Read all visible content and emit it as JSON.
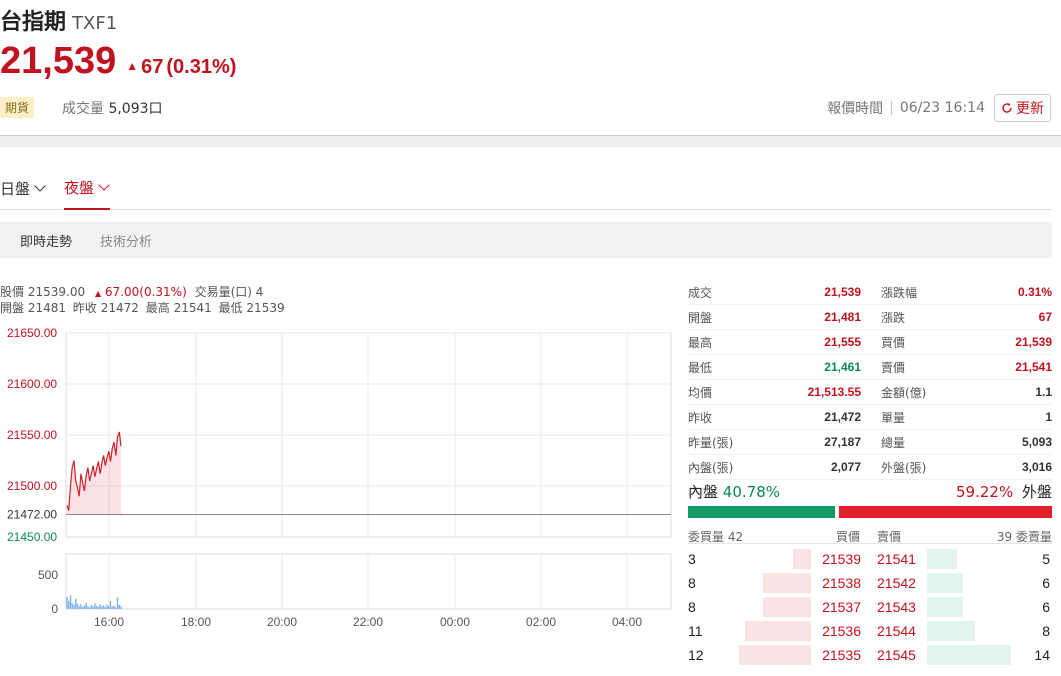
{
  "header": {
    "name": "台指期",
    "code": "TXF1",
    "price": "21,539",
    "change": "67",
    "change_pct": "(0.31%)",
    "badge": "期貨",
    "volume_label": "成交量",
    "volume_value": "5,093口",
    "quote_time_label": "報價時間",
    "quote_time": "06/23 16:14",
    "refresh_label": "更新"
  },
  "session_tabs": [
    {
      "label": "日盤",
      "active": false
    },
    {
      "label": "夜盤",
      "active": true
    }
  ],
  "sub_tabs": [
    {
      "label": "即時走勢",
      "active": true
    },
    {
      "label": "技術分析",
      "active": false
    }
  ],
  "chart_info": {
    "index_label": "股價",
    "index_value": "21539.00",
    "change": "67.00(0.31%)",
    "trade_vol_label": "交易量(口)",
    "trade_vol_value": "4",
    "open_label": "開盤",
    "open_value": "21481",
    "prev_label": "昨收",
    "prev_value": "21472",
    "high_label": "最高",
    "high_value": "21541",
    "low_label": "最低",
    "low_value": "21539"
  },
  "chart_data": {
    "type": "line",
    "x_ticks": [
      "16:00",
      "18:00",
      "20:00",
      "22:00",
      "00:00",
      "02:00",
      "04:00"
    ],
    "y_ticks": [
      "21650.00",
      "21600.00",
      "21550.00",
      "21500.00",
      "21472.00",
      "21450.00"
    ],
    "ylim": [
      21450,
      21650
    ],
    "reference": 21472,
    "price_series": [
      21481,
      21476,
      21500,
      21518,
      21525,
      21505,
      21498,
      21490,
      21512,
      21503,
      21495,
      21510,
      21518,
      21505,
      21512,
      21520,
      21509,
      21517,
      21524,
      21512,
      21522,
      21530,
      21520,
      21528,
      21534,
      21524,
      21537,
      21543,
      21530,
      21548,
      21553,
      21539
    ],
    "volume_ticks": [
      "500",
      "0"
    ],
    "volume_ylim": [
      0,
      600
    ],
    "volume_series": [
      180,
      120,
      200,
      90,
      60,
      150,
      80,
      40,
      70,
      30,
      55,
      90,
      40,
      25,
      60,
      35,
      80,
      45,
      30,
      70,
      40,
      55,
      30,
      65,
      45,
      120,
      35,
      50,
      25,
      170,
      60,
      40
    ]
  },
  "stats": [
    {
      "l1": "成交",
      "v1": "21,539",
      "c1": "red",
      "l2": "漲跌幅",
      "v2": "0.31%",
      "c2": "red"
    },
    {
      "l1": "開盤",
      "v1": "21,481",
      "c1": "red",
      "l2": "漲跌",
      "v2": "67",
      "c2": "red"
    },
    {
      "l1": "最高",
      "v1": "21,555",
      "c1": "red",
      "l2": "買價",
      "v2": "21,539",
      "c2": "red"
    },
    {
      "l1": "最低",
      "v1": "21,461",
      "c1": "green",
      "l2": "賣價",
      "v2": "21,541",
      "c2": "red"
    },
    {
      "l1": "均價",
      "v1": "21,513.55",
      "c1": "red",
      "l2": "金額(億)",
      "v2": "1.1",
      "c2": "dark"
    },
    {
      "l1": "昨收",
      "v1": "21,472",
      "c1": "dark",
      "l2": "單量",
      "v2": "1",
      "c2": "dark"
    },
    {
      "l1": "昨量(張)",
      "v1": "27,187",
      "c1": "dark",
      "l2": "總量",
      "v2": "5,093",
      "c2": "dark"
    },
    {
      "l1": "內盤(張)",
      "v1": "2,077",
      "c1": "dark",
      "l2": "外盤(張)",
      "v2": "3,016",
      "c2": "dark"
    }
  ],
  "ratio": {
    "inner_label": "內盤",
    "inner_pct": "40.78%",
    "inner_value": 40.78,
    "outer_label": "外盤",
    "outer_pct": "59.22%",
    "outer_value": 59.22
  },
  "orderbook": {
    "bid_qty_label": "委買量 42",
    "bid_price_label": "買價",
    "ask_price_label": "賣價",
    "ask_qty_label": "39 委賣量",
    "rows": [
      {
        "bid_qty": "3",
        "bid": "21539",
        "ask": "21541",
        "ask_qty": "5"
      },
      {
        "bid_qty": "8",
        "bid": "21538",
        "ask": "21542",
        "ask_qty": "6"
      },
      {
        "bid_qty": "8",
        "bid": "21537",
        "ask": "21543",
        "ask_qty": "6"
      },
      {
        "bid_qty": "11",
        "bid": "21536",
        "ask": "21544",
        "ask_qty": "8"
      },
      {
        "bid_qty": "12",
        "bid": "21535",
        "ask": "21545",
        "ask_qty": "14"
      }
    ]
  },
  "colors": {
    "up": "#c1121f",
    "down": "#0a8a52",
    "inner_bar": "#139a64",
    "outer_bar": "#e0202a"
  }
}
